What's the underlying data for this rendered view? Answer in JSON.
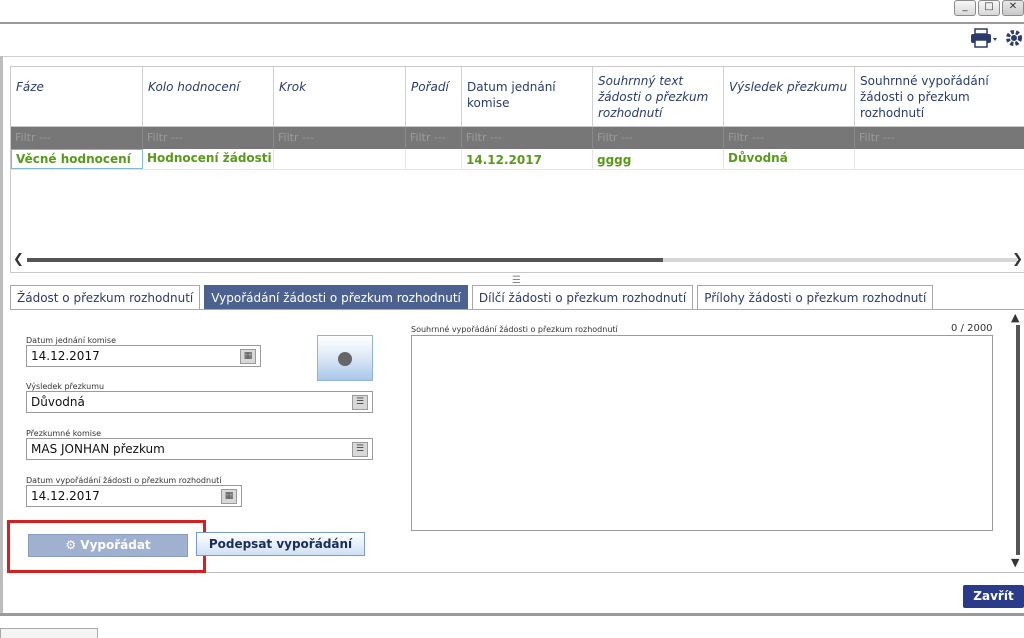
{
  "window": {
    "minimize": "_",
    "maximize": "□",
    "close": "✕"
  },
  "toolbar": {
    "print_icon": "printer-icon",
    "settings_icon": "gear-icon"
  },
  "grid": {
    "columns": [
      "Fáze",
      "Kolo hodnocení",
      "Krok",
      "Pořadí",
      "Datum jednání komise",
      "Souhrnný text žádosti o přezkum rozhodnutí",
      "Výsledek přezkumu",
      "Souhrnné vypořádání žádosti o přezkum rozhodnutí"
    ],
    "filter_placeholder": "Filtr ---",
    "row": [
      "Věcné hodnocení",
      "Hodnocení žádosti o pc",
      "",
      "",
      "14.12.2017",
      "gggg",
      "Důvodná",
      ""
    ]
  },
  "tabs": [
    "Žádost o přezkum rozhodnutí",
    "Vypořádání žádosti o přezkum rozhodnutí",
    "Dílčí žádosti o přezkum rozhodnutí",
    "Přílohy žádosti o přezkum rozhodnutí"
  ],
  "form": {
    "meeting_date_label": "Datum jednání komise",
    "meeting_date_value": "14.12.2017",
    "result_label": "Výsledek přezkumu",
    "result_value": "Důvodná",
    "committee_label": "Přezkumné komise",
    "committee_value": "MAS JONHAN přezkum",
    "settle_date_label": "Datum vypořádání žádosti o přezkum rozhodnutí",
    "settle_date_value": "14.12.2017",
    "summary_label": "Souhrnné vypořádání žádosti o přezkum rozhodnutí",
    "summary_counter": "0 / 2000",
    "summary_value": ""
  },
  "buttons": {
    "settle": "Vypořádat",
    "sign": "Podepsat vypořádání",
    "close": "Zavřít"
  }
}
